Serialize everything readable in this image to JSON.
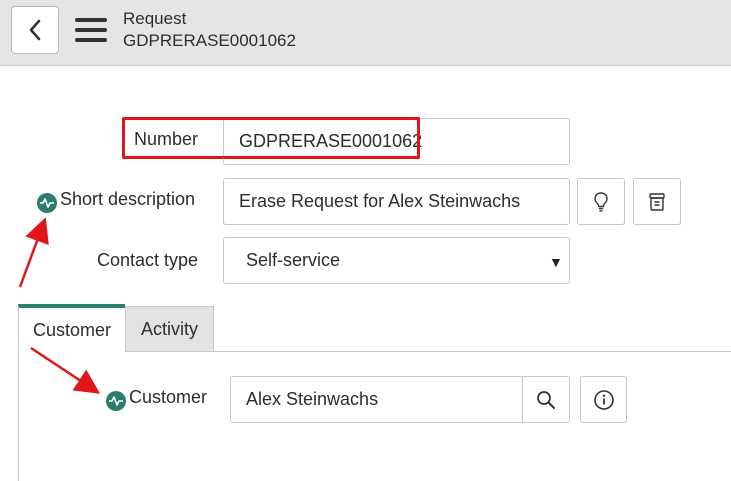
{
  "header": {
    "title": "Request",
    "subtitle": "GDPRERASE0001062"
  },
  "form": {
    "number": {
      "label": "Number",
      "value": "GDPRERASE0001062"
    },
    "short_description": {
      "label": "Short description",
      "value": "Erase Request for Alex Steinwachs"
    },
    "contact_type": {
      "label": "Contact type",
      "value": "Self-service"
    }
  },
  "tabs": [
    {
      "label": "Customer",
      "active": true
    },
    {
      "label": "Activity",
      "active": false
    }
  ],
  "customer": {
    "label": "Customer",
    "value": "Alex Steinwachs"
  },
  "colors": {
    "accent": "#2f7f6f",
    "annotation": "#e0161b",
    "header_bg": "#e4e5e6"
  },
  "icons": [
    "chevron-left-icon",
    "hamburger-menu-icon",
    "lightbulb-icon",
    "archive-icon",
    "search-icon",
    "info-icon",
    "mandatory-indicator-icon"
  ]
}
